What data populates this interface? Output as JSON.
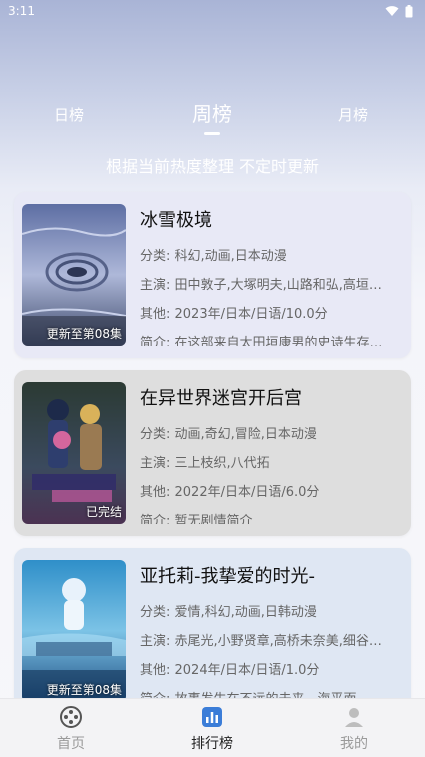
{
  "status": {
    "time": "3:11"
  },
  "tabs": [
    {
      "label": "日榜",
      "active": false
    },
    {
      "label": "周榜",
      "active": true
    },
    {
      "label": "月榜",
      "active": false
    }
  ],
  "subtitle": "根据当前热度整理 不定时更新",
  "labels": {
    "genre": "分类: ",
    "cast": "主演: ",
    "other": "其他: ",
    "intro": "简介: "
  },
  "items": [
    {
      "title": "冰雪极境",
      "badge": "更新至第08集",
      "genre": "科幻,动画,日本动漫",
      "cast": "田中敦子,大塚明夫,山路和弘,高垣彩陽",
      "other": "2023年/日本/日语/10.0分",
      "intro": "在这部来自太田垣康男的史诗生存故事中"
    },
    {
      "title": "在异世界迷宫开后宫",
      "badge": "已完结",
      "genre": "动画,奇幻,冒险,日本动漫",
      "cast": "三上枝织,八代拓",
      "other": "2022年/日本/日语/6.0分",
      "intro": "暂无剧情简介"
    },
    {
      "title": "亚托莉-我挚爱的时光-",
      "badge": "更新至第08集",
      "genre": "爱情,科幻,动画,日韩动漫",
      "cast": "赤尾光,小野贤章,高桥未奈美,细谷佳正",
      "other": "2024年/日本/日语/1.0分",
      "intro": "    故事发生在不远的未来，海平面"
    }
  ],
  "nav": [
    {
      "label": "首页",
      "icon": "film-reel-icon",
      "active": false
    },
    {
      "label": "排行榜",
      "icon": "chart-icon",
      "active": true
    },
    {
      "label": "我的",
      "icon": "user-icon",
      "active": false
    }
  ],
  "colors": {
    "accent": "#3b7dd8",
    "active_text": "#222222",
    "inactive_text": "#9a9a9a"
  }
}
